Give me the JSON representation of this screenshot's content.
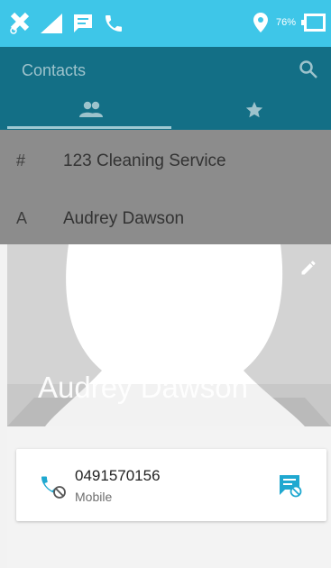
{
  "status": {
    "battery": "76%"
  },
  "header": {
    "title": "Contacts"
  },
  "contacts": [
    {
      "letter": "#",
      "name": "123 Cleaning Service"
    },
    {
      "letter": "A",
      "name": "Audrey Dawson"
    }
  ],
  "detail": {
    "name": "Audrey Dawson",
    "phone": {
      "number": "0491570156",
      "type": "Mobile"
    }
  },
  "colors": {
    "status_bar": "#3ec6e8",
    "header_dimmed": "#136f86",
    "accent": "#1fa8d0"
  }
}
